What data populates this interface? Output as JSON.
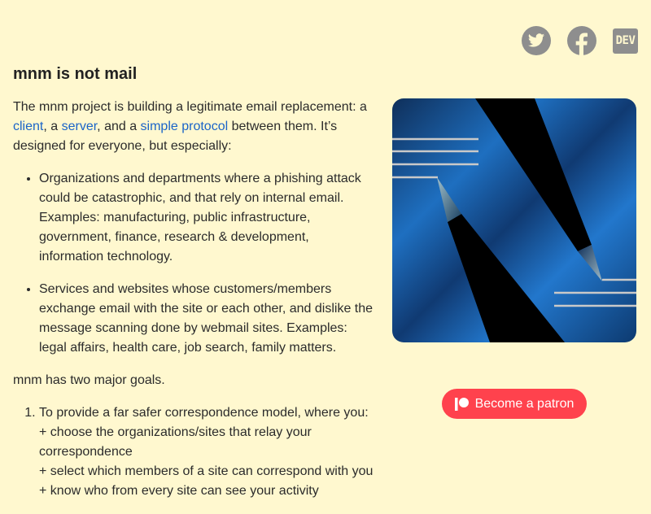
{
  "social": [
    {
      "name": "twitter",
      "icon": "twitter-icon"
    },
    {
      "name": "facebook",
      "icon": "facebook-icon"
    },
    {
      "name": "dev",
      "icon": "dev-icon",
      "label": "DEV"
    }
  ],
  "header": {
    "title": "mnm is not mail"
  },
  "intro": {
    "t1": "The mnm project is building a legitimate email replacement: a ",
    "link_client": "client",
    "t2": ", a ",
    "link_server": "server",
    "t3": ", and a ",
    "link_protocol": "simple protocol",
    "t4": " between them. It’s designed for everyone, but especially:"
  },
  "audience": [
    "Organizations and departments where a phishing attack could be catastrophic, and that rely on internal email. Examples: manufacturing, public infrastructure, government, finance, research & development, information technology.",
    "Services and websites whose customers/members exchange email with the site or each other, and dislike the message scanning done by webmail sites. Examples: legal affairs, health care, job search, family matters."
  ],
  "goals_intro": "mnm has two major goals.",
  "goals": {
    "g1_head": "To provide a far safer correspondence model, where you:",
    "g1_a": "+ choose the organizations/sites that relay your correspondence",
    "g1_b": "+ select which members of a site can correspond with you",
    "g1_c": "+ know who from every site can see your activity"
  },
  "patron": {
    "label": "Become a patron",
    "icon": "patreon-icon"
  },
  "colors": {
    "background": "#fff8cf",
    "link": "#1a64c8",
    "patron": "#ff424d",
    "icon": "#8e8e8e"
  }
}
